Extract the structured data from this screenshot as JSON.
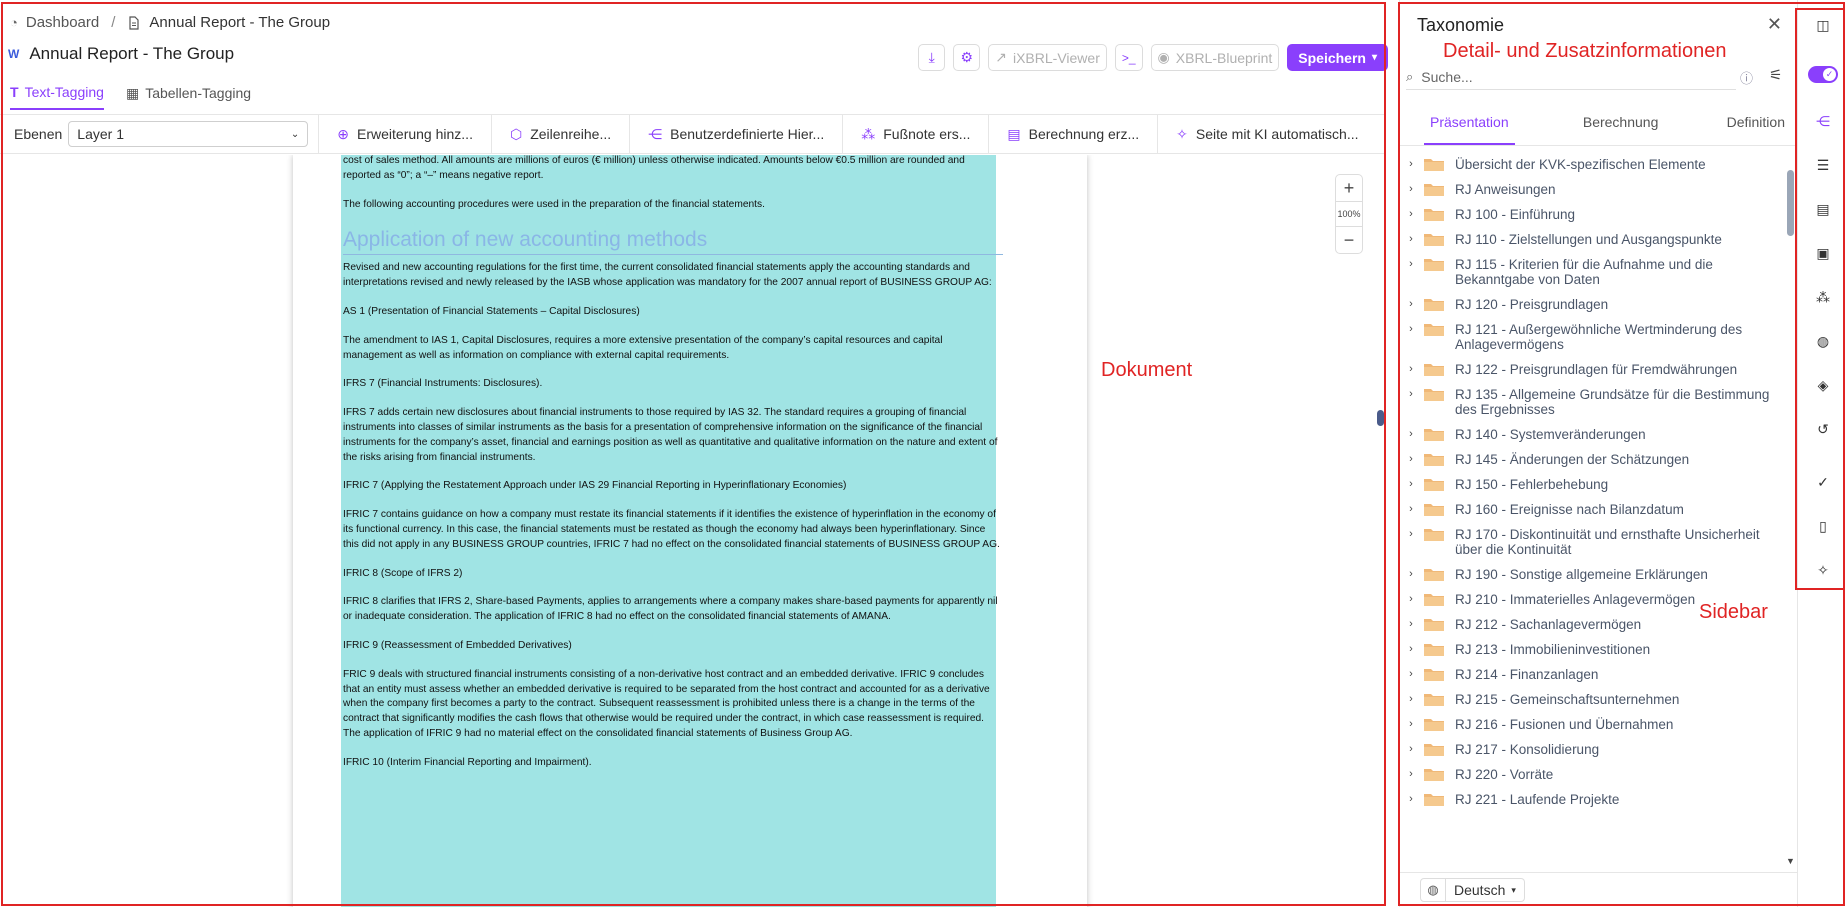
{
  "breadcrumb": {
    "dashboard": "Dashboard",
    "separator": "/",
    "current": "Annual Report - The Group"
  },
  "header": {
    "title": "Annual Report - The Group",
    "title_icon": "W",
    "ixbrl_viewer": "iXBRL-Viewer",
    "xbrl_blueprint": "XBRL-Blueprint",
    "save": "Speichern"
  },
  "tabs": [
    {
      "label": "Text-Tagging"
    },
    {
      "label": "Tabellen-Tagging"
    }
  ],
  "layer_bar": {
    "label": "Ebenen",
    "selected": "Layer 1",
    "actions": [
      {
        "label": "Erweiterung hinz...",
        "icon": "plus-circle-icon"
      },
      {
        "label": "Zeilenreihe...",
        "icon": "hexagon-icon"
      },
      {
        "label": "Benutzerdefinierte Hier...",
        "icon": "hierarchy-icon"
      },
      {
        "label": "Fußnote ers...",
        "icon": "footprints-icon"
      },
      {
        "label": "Berechnung erz...",
        "icon": "calculator-icon"
      },
      {
        "label": "Seite mit KI automatisch...",
        "icon": "magic-wand-icon"
      }
    ]
  },
  "document": {
    "paragraphs_top": [
      "cost of sales method. All amounts are millions of euros (€ million) unless otherwise indicated. Amounts below €0.5 million are rounded and reported as “0”; a “–” means negative report.",
      "The following accounting procedures were used in the preparation of the financial statements."
    ],
    "heading": "Application of new accounting methods",
    "paragraphs": [
      "Revised and new accounting regulations for the first time, the current consolidated financial statements apply the accounting standards and interpretations revised and newly released by the IASB whose application was mandatory for the 2007 annual report of BUSINESS GROUP AG:",
      "AS 1 (Presentation of Financial Statements – Capital Disclosures)",
      "The amendment to IAS 1, Capital Disclosures, requires a more extensive presentation of the company’s capital resources and capital management as well as information on compliance with external capital requirements.",
      "IFRS 7 (Financial Instruments: Disclosures).",
      "IFRS 7 adds certain new disclosures about financial instruments to those required by IAS 32. The standard requires a grouping of financial instruments into classes of similar instruments as the basis for a presentation of comprehensive information on the significance of the financial instruments for the company’s asset, financial and earnings position as well as quantitative and qualitative information on the nature and extent of the risks arising from financial instruments.",
      "IFRIC 7 (Applying the Restatement Approach under IAS 29 Financial Reporting in Hyperinflationary Economies)",
      "IFRIC 7 contains guidance on how a company must restate its financial statements if it identifies the existence of hyperinflation in the economy of its functional currency. In this case, the financial statements must be restated as though the economy had always been hyperinflationary. Since this did not apply in any BUSINESS GROUP countries, IFRIC 7 had no effect on the consolidated financial statements of BUSINESS GROUP AG.",
      "IFRIC 8 (Scope of IFRS 2)",
      "IFRIC 8 clarifies that IFRS 2, Share-based Payments, applies to arrangements where a company makes share-based payments for apparently nil or inadequate consideration. The application of IFRIC 8 had no effect on the consolidated financial statements of AMANA.",
      "IFRIC 9 (Reassessment of Embedded Derivatives)",
      "FRIC 9 deals with structured financial instruments consisting of a non-derivative host contract and an embedded derivative. IFRIC 9 concludes that an entity must assess whether an embedded derivative is required to be separated from the host contract and accounted for as a derivative when the company first becomes a party to the contract. Subsequent reassessment is prohibited unless there is a change in the terms of the contract that significantly modifies the cash flows that otherwise would be required under the contract, in which case reassessment is required. The application of IFRIC 9 had no material effect on the consolidated financial statements of Business Group AG.",
      "IFRIC 10 (Interim Financial Reporting and Impairment)."
    ],
    "zoom_in": "+",
    "zoom_level": "100%",
    "zoom_out": "−"
  },
  "sidebar": {
    "title": "Taxonomie",
    "close": "✕",
    "search_placeholder": "Suche...",
    "tabs": [
      {
        "label": "Präsentation"
      },
      {
        "label": "Berechnung"
      },
      {
        "label": "Definition"
      }
    ],
    "items": [
      "Übersicht der KVK-spezifischen Elemente",
      "RJ Anweisungen",
      "RJ 100 - Einführung",
      "RJ 110 - Zielstellungen und Ausgangspunkte",
      "RJ 115 - Kriterien für die Aufnahme und die Bekanntgabe von Daten",
      "RJ 120 - Preisgrundlagen",
      "RJ 121 - Außergewöhnliche Wertminderung des Anlagevermögens",
      "RJ 122 - Preisgrundlagen für Fremdwährungen",
      "RJ 135 - Allgemeine Grundsätze für die Bestimmung des Ergebnisses",
      "RJ 140 - Systemveränderungen",
      "RJ 145 - Änderungen der Schätzungen",
      "RJ 150 - Fehlerbehebung",
      "RJ 160 - Ereignisse nach Bilanzdatum",
      "RJ 170 - Diskontinuität und ernsthafte Unsicherheit über die Kontinuität",
      "RJ 190 - Sonstige allgemeine Erklärungen",
      "RJ 210 - Immaterielles Anlagevermögen",
      "RJ 212 - Sachanlagevermögen",
      "RJ 213 - Immobilieninvestitionen",
      "RJ 214 - Finanzanlagen",
      "RJ 215 - Gemeinschaftsunternehmen",
      "RJ 216 - Fusionen und Übernahmen",
      "RJ 217 - Konsolidierung",
      "RJ 220 - Vorräte",
      "RJ 221 - Laufende Projekte"
    ],
    "language": "Deutsch"
  },
  "annotations": {
    "details": "Detail- und Zusatzinformationen",
    "document": "Dokument",
    "sidebar": "Sidebar"
  },
  "colors": {
    "accent": "#8a3ffc",
    "tag_highlight": "#a0e4e4",
    "annotation": "#e02424"
  }
}
